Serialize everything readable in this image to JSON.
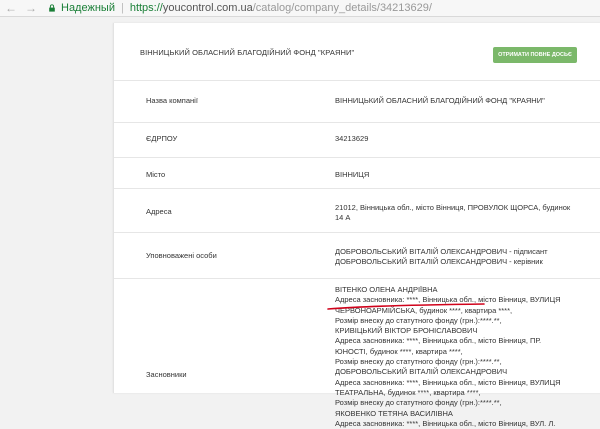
{
  "browser": {
    "secure_label": "Надежный",
    "url_protocol": "https://",
    "url_host": "youcontrol.com.ua",
    "url_path": "/catalog/company_details/34213629/"
  },
  "card": {
    "title": "ВІННИЦЬКИЙ ОБЛАСНИЙ БЛАГОДІЙНИЙ ФОНД \"КРАЯНИ\"",
    "full_dossier_button": "ОТРИМАТИ ПОВНЕ ДОСЬЄ"
  },
  "rows": [
    {
      "label": "Назва компанії",
      "value": "ВІННИЦЬКИЙ ОБЛАСНИЙ БЛАГОДІЙНИЙ ФОНД \"КРАЯНИ\""
    },
    {
      "label": "ЄДРПОУ",
      "value": "34213629"
    },
    {
      "label": "Місто",
      "value": "ВІННИЦЯ"
    },
    {
      "label": "Адреса",
      "value_lines": [
        "21012, Вінницька обл., місто Вінниця, ПРОВУЛОК ЩОРСА, будинок",
        "14 А"
      ]
    },
    {
      "label": "Уповноважені особи",
      "value_lines": [
        "ДОБРОВОЛЬСЬКИЙ ВІТАЛІЙ ОЛЕКСАНДРОВИЧ - підписант",
        "ДОБРОВОЛЬСЬКИЙ ВІТАЛІЙ ОЛЕКСАНДРОВИЧ - керівник"
      ]
    },
    {
      "label": "Засновники",
      "value_lines": [
        "ВІТЕНКО ОЛЕНА АНДРІЇВНА",
        "Адреса засновника: ****, Вінницька обл., місто Вінниця, ВУЛИЦЯ",
        "ЧЕРВОНОАРМІЙСЬКА, будинок ****, квартира ****,",
        "Розмір внеску до статутного фонду (грн.):****.**,",
        "КРИВІЦЬКИЙ ВІКТОР БРОНІСЛАВОВИЧ",
        "Адреса засновника: ****, Вінницька обл., місто Вінниця, ПР.",
        "ЮНОСТІ, будинок ****, квартира ****,",
        "Розмір внеску до статутного фонду (грн.):****.**,",
        "ДОБРОВОЛЬСЬКИЙ ВІТАЛІЙ ОЛЕКСАНДРОВИЧ",
        "Адреса засновника: ****, Вінницька обл., місто Вінниця, ВУЛИЦЯ",
        "ТЕАТРАЛЬНА, будинок ****, квартира ****,",
        "Розмір внеску до статутного фонду (грн.):****.**,",
        "ЯКОВЕНКО ТЕТЯНА ВАСИЛІВНА",
        "Адреса засновника: ****, Вінницька обл., місто Вінниця, ВУЛ. Л."
      ]
    }
  ],
  "colors": {
    "accent_green": "#7bb86a",
    "annotation_red": "#d0021b"
  }
}
